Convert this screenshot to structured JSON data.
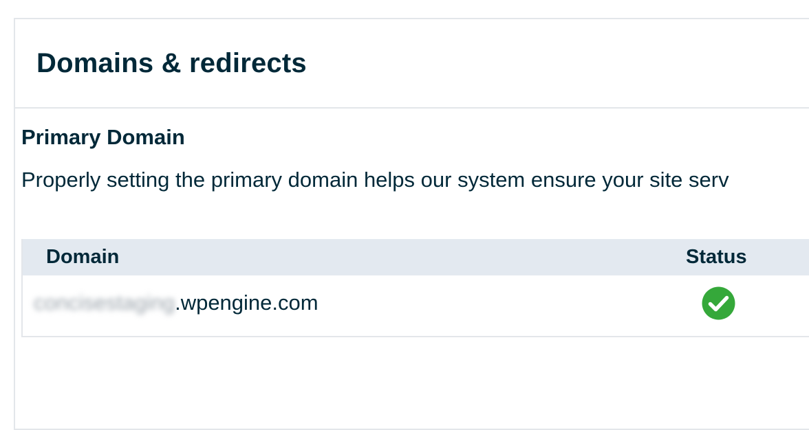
{
  "header": {
    "title": "Domains & redirects"
  },
  "primary_domain": {
    "title": "Primary Domain",
    "description": "Properly setting the primary domain helps our system ensure your site serv"
  },
  "table": {
    "columns": {
      "domain": "Domain",
      "status": "Status"
    },
    "rows": [
      {
        "domain_prefix": "concisestaging",
        "domain_suffix": ".wpengine.com",
        "status_icon": "check-circle-icon",
        "status_color": "#35a83a"
      }
    ]
  },
  "colors": {
    "text": "#002838",
    "table_header_bg": "#e3e9f0",
    "border": "#e3e6ea",
    "success": "#35a83a"
  }
}
